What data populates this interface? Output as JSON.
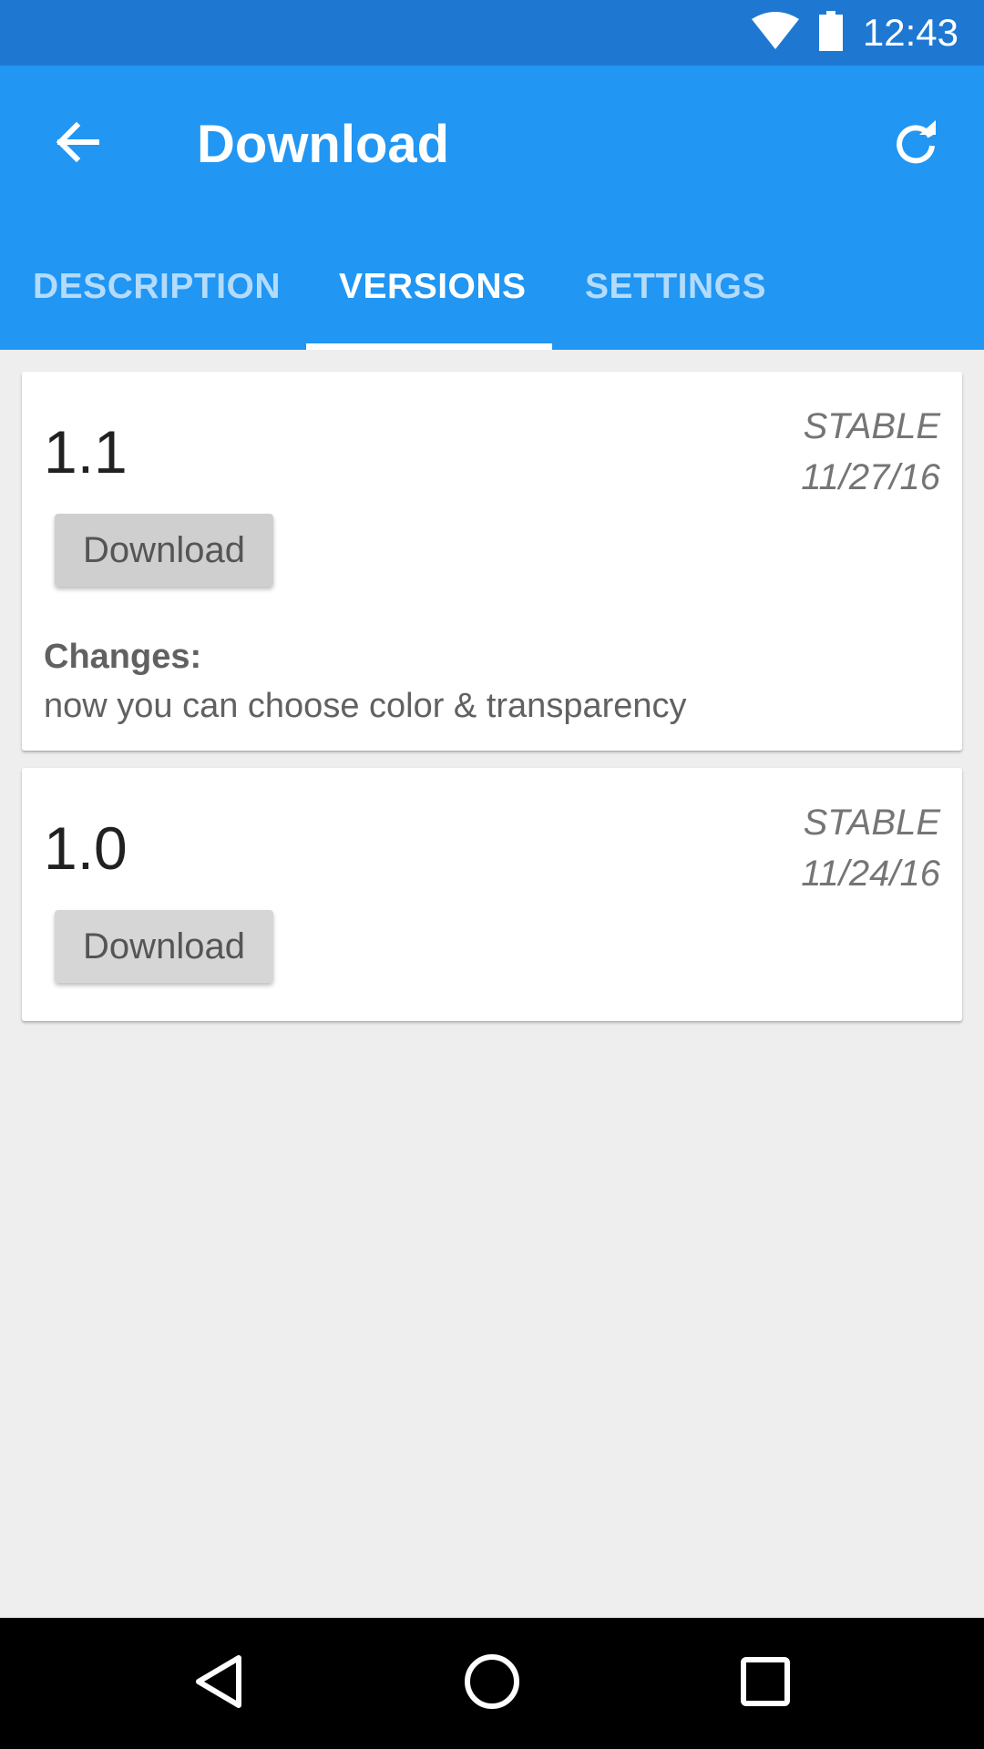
{
  "status_bar": {
    "time": "12:43",
    "icons": [
      "wifi-icon",
      "battery-icon"
    ]
  },
  "app_bar": {
    "title": "Download",
    "back_icon": "arrow-left-icon",
    "refresh_icon": "refresh-icon",
    "color": "#2196f3"
  },
  "tabs": [
    {
      "label": "DESCRIPTION",
      "active": false
    },
    {
      "label": "VERSIONS",
      "active": true
    },
    {
      "label": "SETTINGS",
      "active": false
    }
  ],
  "versions": [
    {
      "name": "1.1",
      "channel": "STABLE",
      "date": "11/27/16",
      "button_label": "Download",
      "changes_heading": "Changes:",
      "changes_text": "now you can choose color & transparency"
    },
    {
      "name": "1.0",
      "channel": "STABLE",
      "date": "11/24/16",
      "button_label": "Download"
    }
  ],
  "nav_bar": {
    "icons": [
      "back-triangle-icon",
      "home-circle-icon",
      "recents-square-icon"
    ]
  }
}
